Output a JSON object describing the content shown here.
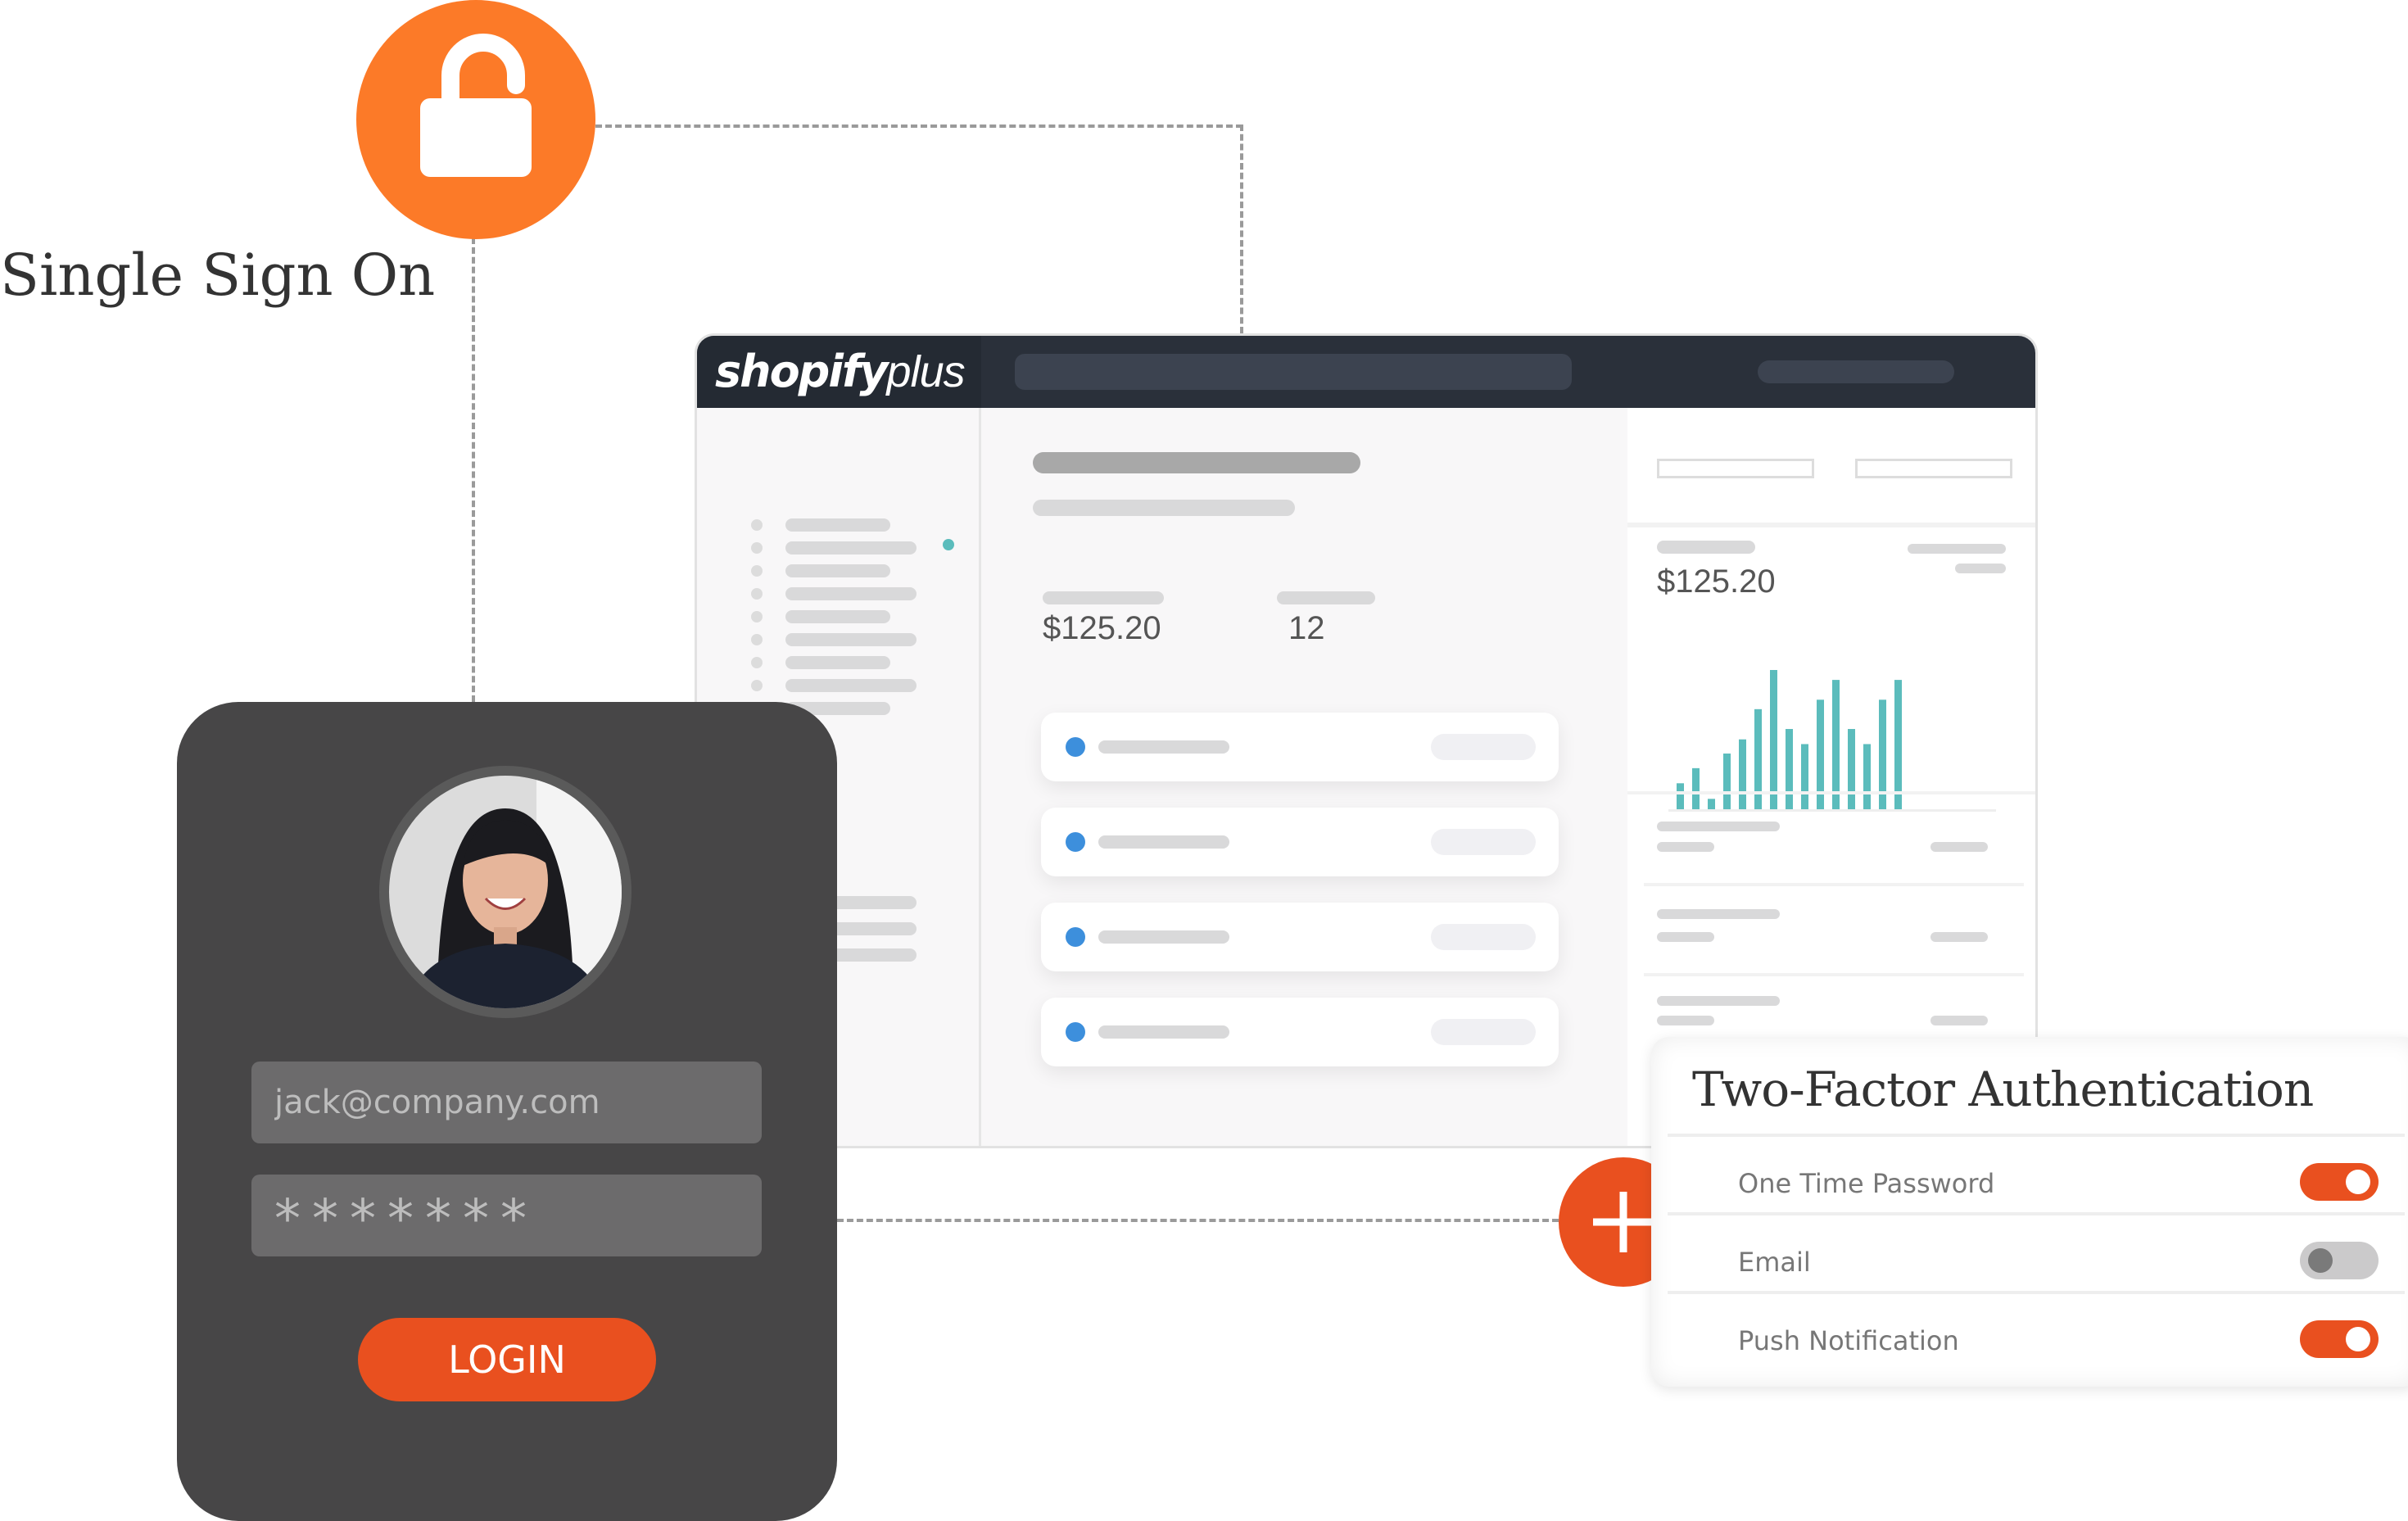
{
  "brand": {
    "logo_bold": "shopify",
    "logo_light": "plus",
    "accent": "#e9501f",
    "lock_color": "#fc7a28",
    "chart_color": "#5bbcbc"
  },
  "sso": {
    "title": "Single Sign On",
    "icon": "unlock-icon"
  },
  "dashboard": {
    "metric_1": "$125.20",
    "metric_2": "12",
    "side_metric": "$125.20",
    "mini_chart": {
      "type": "bar",
      "values": [
        55,
        87,
        22,
        118,
        148,
        212,
        295,
        170,
        138,
        232,
        274,
        170,
        138,
        232,
        274
      ]
    }
  },
  "login": {
    "email_value": "jack@company.com",
    "password_value": "*******",
    "button_label": "LOGIN"
  },
  "two_factor": {
    "title": "Two-Factor Authentication",
    "options": [
      {
        "label": "One Time Password",
        "enabled": true
      },
      {
        "label": "Email",
        "enabled": false
      },
      {
        "label": "Push Notification",
        "enabled": true
      }
    ]
  }
}
